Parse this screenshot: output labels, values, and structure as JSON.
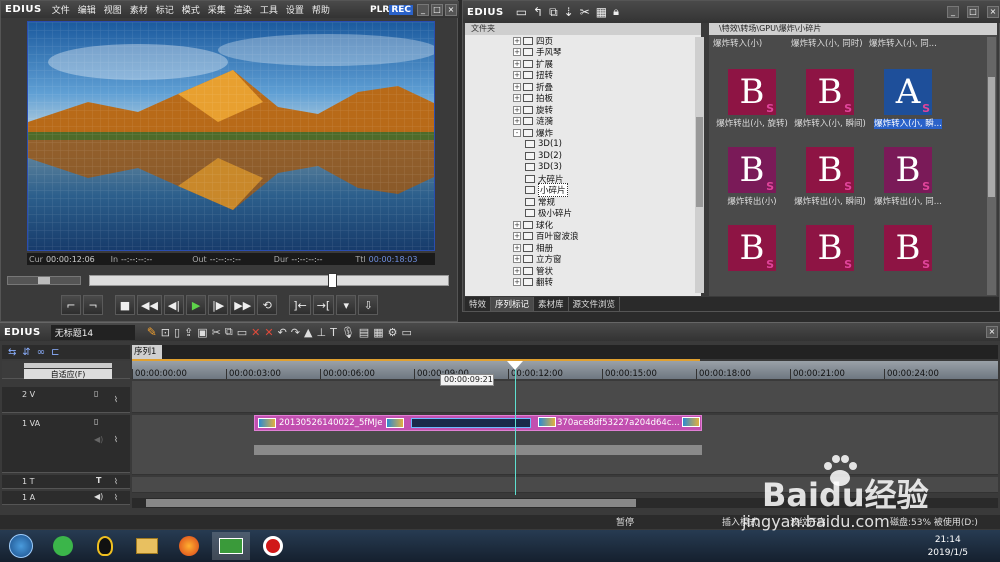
{
  "player": {
    "logo": "EDIUS",
    "menu": [
      "文件",
      "编辑",
      "视图",
      "素材",
      "标记",
      "模式",
      "采集",
      "渲染",
      "工具",
      "设置",
      "帮助"
    ],
    "plr": "PLR",
    "rec": "REC",
    "cur_label": "Cur",
    "cur": "00:00:12:06",
    "in_label": "In",
    "in": "--:--:--:--",
    "out_label": "Out",
    "out": "--:--:--:--",
    "dur_label": "Dur",
    "dur": "--:--:--:--",
    "ttl_label": "Ttl",
    "ttl": "00:00:18:03",
    "scrub_position": 0.68
  },
  "bin": {
    "title": "EDIUS",
    "tree_header": "文件夹",
    "path": "\\特效\\转场\\GPU\\爆炸\\小碎片",
    "tree": [
      {
        "label": "四页",
        "exp": "+"
      },
      {
        "label": "手风琴",
        "exp": "+"
      },
      {
        "label": "扩展",
        "exp": "+"
      },
      {
        "label": "扭转",
        "exp": "+"
      },
      {
        "label": "折叠",
        "exp": "+"
      },
      {
        "label": "拍板",
        "exp": "+"
      },
      {
        "label": "旋转",
        "exp": "+"
      },
      {
        "label": "涟漪",
        "exp": "+"
      },
      {
        "label": "爆炸",
        "exp": "-"
      },
      {
        "label": "3D(1)",
        "child": true
      },
      {
        "label": "3D(2)",
        "child": true
      },
      {
        "label": "3D(3)",
        "child": true
      },
      {
        "label": "大碎片",
        "child": true
      },
      {
        "label": "小碎片",
        "child": true,
        "selected": true
      },
      {
        "label": "常规",
        "child": true
      },
      {
        "label": "极小碎片",
        "child": true
      },
      {
        "label": "球化",
        "exp": "+"
      },
      {
        "label": "百叶窗波浪",
        "exp": "+"
      },
      {
        "label": "相册",
        "exp": "+"
      },
      {
        "label": "立方窗",
        "exp": "+"
      },
      {
        "label": "管状",
        "exp": "+"
      },
      {
        "label": "翻转",
        "exp": "+"
      }
    ],
    "top_row_labels": [
      "爆炸转入(小)",
      "爆炸转入(小, 同时)",
      "爆炸转入(小, 同..."
    ],
    "effects": [
      {
        "name": "爆炸转出(小, 旋转)",
        "letter": "B",
        "bg": "#8e1444",
        "highlight": false
      },
      {
        "name": "爆炸转入(小, 瞬间)",
        "letter": "B",
        "bg": "#8e1444",
        "highlight": false
      },
      {
        "name": "爆炸转入(小, 瞬...",
        "letter": "A",
        "bg": "#1e4f9a",
        "highlight": true
      },
      {
        "name": "爆炸转出(小)",
        "letter": "B",
        "bg": "#7a1a58",
        "highlight": false
      },
      {
        "name": "爆炸转出(小, 瞬间)",
        "letter": "B",
        "bg": "#8e1444",
        "highlight": false
      },
      {
        "name": "爆炸转出(小, 同...",
        "letter": "B",
        "bg": "#7a1a58",
        "highlight": false
      },
      {
        "name": "",
        "letter": "B",
        "bg": "#8e1444",
        "highlight": false
      },
      {
        "name": "",
        "letter": "B",
        "bg": "#8e1444",
        "highlight": false
      },
      {
        "name": "",
        "letter": "B",
        "bg": "#8e1444",
        "highlight": false
      }
    ],
    "tabs": [
      "特效",
      "序列标记",
      "素材库",
      "源文件浏览"
    ],
    "active_tab": 1
  },
  "timeline": {
    "logo": "EDIUS",
    "project": "无标题14",
    "sequence": "序列1",
    "fit_label": "自适应(F)",
    "ruler": [
      "00:00:00:00",
      "00:00:03:00",
      "00:00:06:00",
      "00:00:09:00",
      "00:00:12:00",
      "00:00:15:00",
      "00:00:18:00",
      "00:00:21:00",
      "00:00:24:00"
    ],
    "tooltip": "00:00:09:21",
    "tracks": [
      {
        "name": "2 V"
      },
      {
        "name": "1 VA"
      },
      {
        "name": "1 T"
      },
      {
        "name": "1 A"
      }
    ],
    "clip1": "20130526140022_5fMJe",
    "clip2": "370ace8df53227a204d64c...",
    "status": {
      "pause": "暂停",
      "insert": "插入模式",
      "ripple": "波纹开启",
      "disk": "磁盘:53% 被使用(D:)"
    }
  },
  "taskbar": {
    "time": "21:14",
    "date": "2019/1/5"
  },
  "watermark": {
    "brand": "Baidu经验",
    "url": "jingyan.baidu.com"
  }
}
